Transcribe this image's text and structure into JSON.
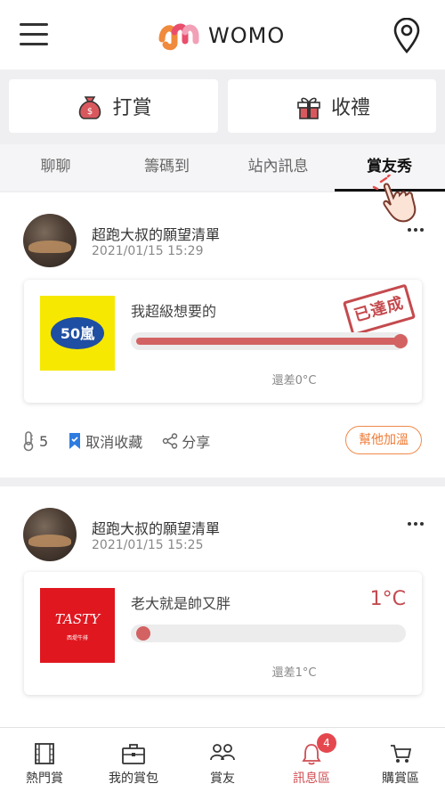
{
  "header": {
    "app_name": "WOMO"
  },
  "actions": {
    "reward_label": "打賞",
    "gift_label": "收禮"
  },
  "tabs": [
    {
      "label": "聊聊"
    },
    {
      "label": "籌碼到"
    },
    {
      "label": "站內訊息"
    },
    {
      "label": "賞友秀",
      "active": true
    }
  ],
  "posts": [
    {
      "title": "超跑大叔的願望清單",
      "time": "2021/01/15 15:29",
      "product_name": "我超級想要的",
      "product_logo_text": "50嵐",
      "stamp": "已達成",
      "progress": 1.0,
      "remaining": "還差0°C",
      "likes": "5",
      "unsave_label": "取消收藏",
      "share_label": "分享",
      "help_label": "幫他加溫"
    },
    {
      "title": "超跑大叔的願望清單",
      "time": "2021/01/15 15:25",
      "product_name": "老大就是帥又胖",
      "product_logo_text": "TASTY",
      "product_logo_subtext": "西堤牛排",
      "temperature": "1°C",
      "progress": 0.0,
      "remaining": "還差1°C"
    }
  ],
  "bottom_nav": [
    {
      "label": "熱門賞",
      "icon": "film-icon"
    },
    {
      "label": "我的賞包",
      "icon": "briefcase-icon"
    },
    {
      "label": "賞友",
      "icon": "friends-icon"
    },
    {
      "label": "訊息區",
      "icon": "bell-icon",
      "active": true,
      "badge": "4"
    },
    {
      "label": "購賞區",
      "icon": "cart-icon"
    }
  ],
  "colors": {
    "accent": "#d36263",
    "orange": "#ef7a34",
    "badge": "#e4484e"
  }
}
